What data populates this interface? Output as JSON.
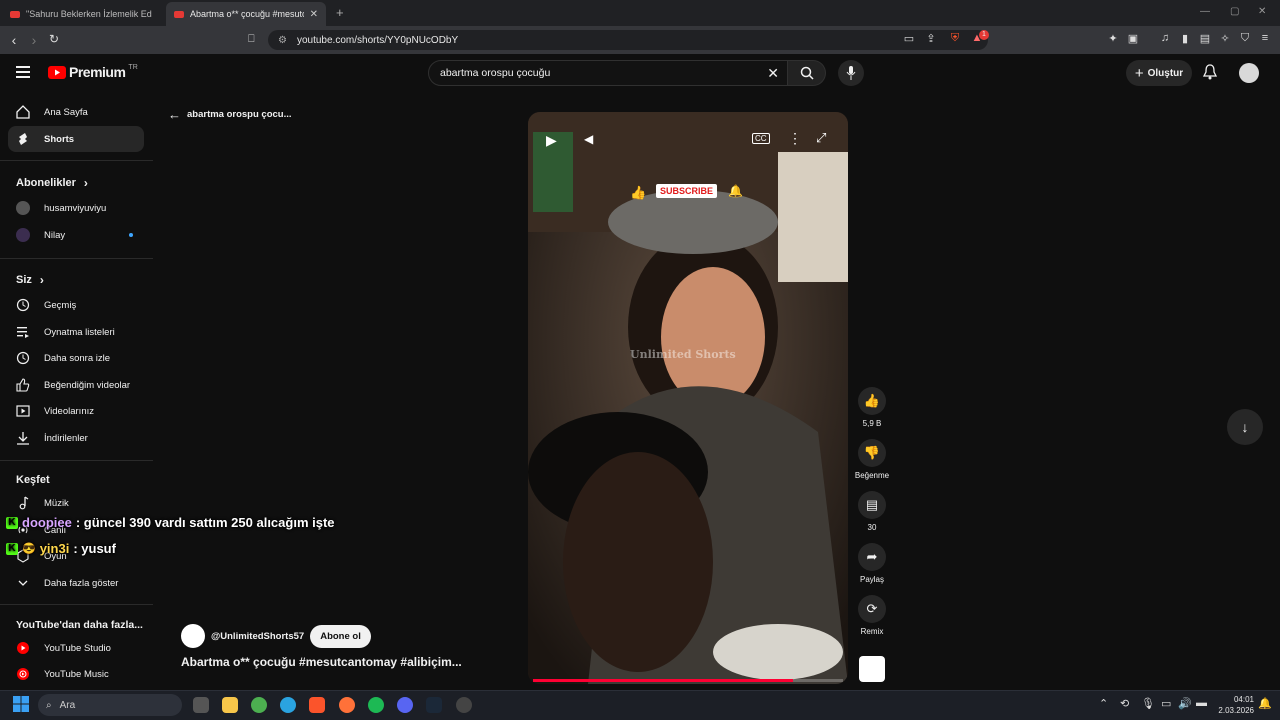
{
  "browser": {
    "tabs": [
      {
        "title": "\"Sahuru Beklerken İzlemelik Edit\" Kis",
        "active": false
      },
      {
        "title": "Abartma o** çocuğu #mesutcan",
        "active": true
      }
    ],
    "url": "youtube.com/shorts/YY0pNUcODbY",
    "notification_count": "1"
  },
  "header": {
    "logo_text": "Premium",
    "logo_region": "TR",
    "search_value": "abartma orospu çocuğu",
    "create_label": "Oluştur"
  },
  "sidebar": {
    "main": [
      {
        "label": "Ana Sayfa",
        "icon": "home-icon"
      },
      {
        "label": "Shorts",
        "icon": "shorts-icon",
        "active": true
      }
    ],
    "subscriptions_title": "Abonelikler",
    "subscriptions": [
      {
        "label": "husamviyuviyu"
      },
      {
        "label": "Nilay"
      }
    ],
    "you_title": "Siz",
    "you": [
      {
        "label": "Geçmiş",
        "icon": "history-icon"
      },
      {
        "label": "Oynatma listeleri",
        "icon": "playlist-icon"
      },
      {
        "label": "Daha sonra izle",
        "icon": "clock-icon"
      },
      {
        "label": "Beğendiğim videolar",
        "icon": "thumbs-up-icon"
      },
      {
        "label": "Videolarınız",
        "icon": "video-icon"
      },
      {
        "label": "İndirilenler",
        "icon": "download-icon"
      }
    ],
    "explore_title": "Keşfet",
    "explore": [
      {
        "label": "Müzik",
        "icon": "music-icon"
      },
      {
        "label": "Canlı",
        "icon": "live-icon"
      },
      {
        "label": "Oyun",
        "icon": "gaming-icon"
      }
    ],
    "show_more": "Daha fazla göster",
    "more_title": "YouTube'dan daha fazla...",
    "more": [
      {
        "label": "YouTube Studio"
      },
      {
        "label": "YouTube Music"
      }
    ]
  },
  "shorts": {
    "back_title": "abartma orospu çocu...",
    "channel": "@UnlimitedShorts57",
    "subscribe_label": "Abone ol",
    "title": "Abartma o** çocuğu #mesutcantomay #alibiçim...",
    "watermark": "Unlimited Shorts",
    "overlay_subscribe": "SUBSCRIBE",
    "likes": "5,9 B",
    "dislike_label": "Beğenme",
    "comments": "30",
    "share_label": "Paylaş",
    "remix_label": "Remix",
    "progress": 0.84
  },
  "chat": [
    {
      "user": "doopiee",
      "message": " : güncel 390 vardı sattım 250 alıcağım işte"
    },
    {
      "user": "yin3i",
      "message": " : yusuf"
    }
  ],
  "taskbar": {
    "search_placeholder": "Ara",
    "time": "04:01",
    "date": "2.03.2026"
  },
  "colors": {
    "youtube_red": "#ff0000",
    "background": "#0f0f0f",
    "kick_green": "#53fc18"
  }
}
